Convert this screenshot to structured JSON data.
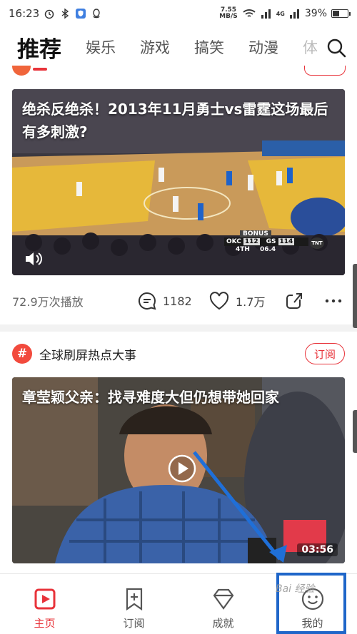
{
  "status_bar": {
    "time": "16:23",
    "net_speed_value": "7.55",
    "net_speed_unit": "MB/S",
    "network": "4G",
    "battery": "39%",
    "battery_level": 0.39
  },
  "tabs": [
    "推荐",
    "娱乐",
    "游戏",
    "搞笑",
    "动漫",
    "体"
  ],
  "feed": {
    "card1": {
      "title": "绝杀反绝杀！2013年11月勇士vs雷霆这场最后有多刺激?",
      "plays": "72.9万次播放",
      "comments": "1182",
      "likes": "1.7万",
      "scoreboard": {
        "label": "BONUS",
        "team1": "OKC",
        "score1": "112",
        "team2": "GS",
        "score2": "114",
        "quarter": "4TH",
        "clock": "06.4",
        "network": "TNT"
      }
    },
    "card2": {
      "channel_icon": "#",
      "channel": "全球刷屏热点大事",
      "subscribe": "订阅",
      "title": "章莹颖父亲：找寻难度大但仍想带她回家",
      "duration": "03:56"
    }
  },
  "bottom_nav": [
    {
      "label": "主页",
      "icon": "home-play-icon",
      "active": true
    },
    {
      "label": "订阅",
      "icon": "bookmark-plus-icon",
      "active": false
    },
    {
      "label": "成就",
      "icon": "diamond-icon",
      "active": false
    },
    {
      "label": "我的",
      "icon": "smiley-face-icon",
      "active": false
    }
  ],
  "watermark": "Bai 经验",
  "colors": {
    "accent": "#e8333a",
    "highlight": "#1f66c9",
    "channel_icon": "#f24a3d"
  }
}
